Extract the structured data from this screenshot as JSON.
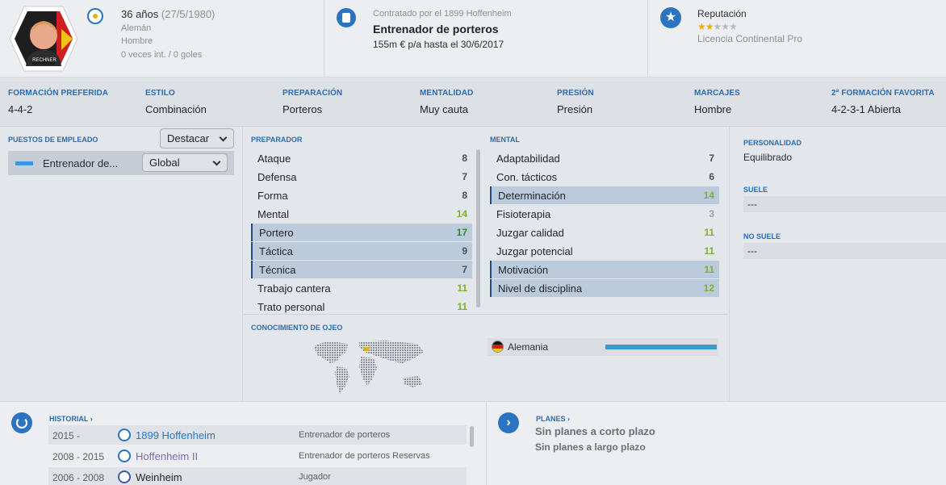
{
  "staff": {
    "age": "36 años",
    "dob": "(27/5/1980)",
    "nationality": "Alemán",
    "gender": "Hombre",
    "caps": "0 veces int. / 0 goles",
    "name_on_photo": "RECHNER"
  },
  "contract": {
    "club_line": "Contratado por el 1899 Hoffenheim",
    "role": "Entrenador de porteros",
    "wage": "155m € p/a hasta el 30/6/2017"
  },
  "reputation": {
    "label": "Reputación",
    "stars": 1.5,
    "stars_max": 5,
    "license": "Licencia Continental Pro"
  },
  "formation": [
    {
      "label": "FORMACIÓN PREFERIDA",
      "value": "4-4-2"
    },
    {
      "label": "ESTILO",
      "value": "Combinación"
    },
    {
      "label": "PREPARACIÓN",
      "value": "Porteros"
    },
    {
      "label": "MENTALIDAD",
      "value": "Muy cauta"
    },
    {
      "label": "PRESIÓN",
      "value": "Presión"
    },
    {
      "label": "MARCAJES",
      "value": "Hombre"
    },
    {
      "label": "2ª FORMACIÓN FAVORITA",
      "value": "4-2-3-1 Abierta"
    }
  ],
  "roles": {
    "title": "PUESTOS DE EMPLEADO",
    "highlight_button": "Destacar",
    "role_name": "Entrenador de...",
    "scope_select": "Global"
  },
  "coaching": {
    "title": "PREPARADOR",
    "rows": [
      {
        "name": "Ataque",
        "value": "8"
      },
      {
        "name": "Defensa",
        "value": "7"
      },
      {
        "name": "Forma",
        "value": "8"
      },
      {
        "name": "Mental",
        "value": "14"
      },
      {
        "name": "Portero",
        "value": "17"
      },
      {
        "name": "Táctica",
        "value": "9"
      },
      {
        "name": "Técnica",
        "value": "7"
      },
      {
        "name": "Trabajo cantera",
        "value": "11"
      },
      {
        "name": "Trato personal",
        "value": "11"
      }
    ]
  },
  "mental": {
    "title": "MENTAL",
    "rows": [
      {
        "name": "Adaptabilidad",
        "value": "7"
      },
      {
        "name": "Con. tácticos",
        "value": "6"
      },
      {
        "name": "Determinación",
        "value": "14"
      },
      {
        "name": "Fisioterapia",
        "value": "3"
      },
      {
        "name": "Juzgar calidad",
        "value": "11"
      },
      {
        "name": "Juzgar potencial",
        "value": "11"
      },
      {
        "name": "Motivación",
        "value": "11"
      },
      {
        "name": "Nivel de disciplina",
        "value": "12"
      }
    ]
  },
  "scouting": {
    "title": "CONOCIMIENTO DE OJEO",
    "country": "Alemania",
    "knowledge": 1.0
  },
  "personality": {
    "title": "PERSONALIDAD",
    "value": "Equilibrado",
    "tends_title": "SUELE",
    "tends_value": "---",
    "not_tends_title": "NO SUELE",
    "not_tends_value": "---"
  },
  "history": {
    "title": "HISTORIAL",
    "rows": [
      {
        "years": "2015 -",
        "club": "1899 Hoffenheim",
        "role": "Entrenador de porteros"
      },
      {
        "years": "2008 - 2015",
        "club": "Hoffenheim II",
        "role": "Entrenador de porteros Reservas"
      },
      {
        "years": "2006 - 2008",
        "club": "Weinheim",
        "role": "Jugador"
      }
    ]
  },
  "plans": {
    "title": "PLANES",
    "short": "Sin planes a corto plazo",
    "long": "Sin planes a largo plazo"
  },
  "colors": {
    "accent": "#2a6cb0",
    "highlight_row": "#bccbdc",
    "good": "#7fb030",
    "excellent": "#2f8a2f"
  }
}
